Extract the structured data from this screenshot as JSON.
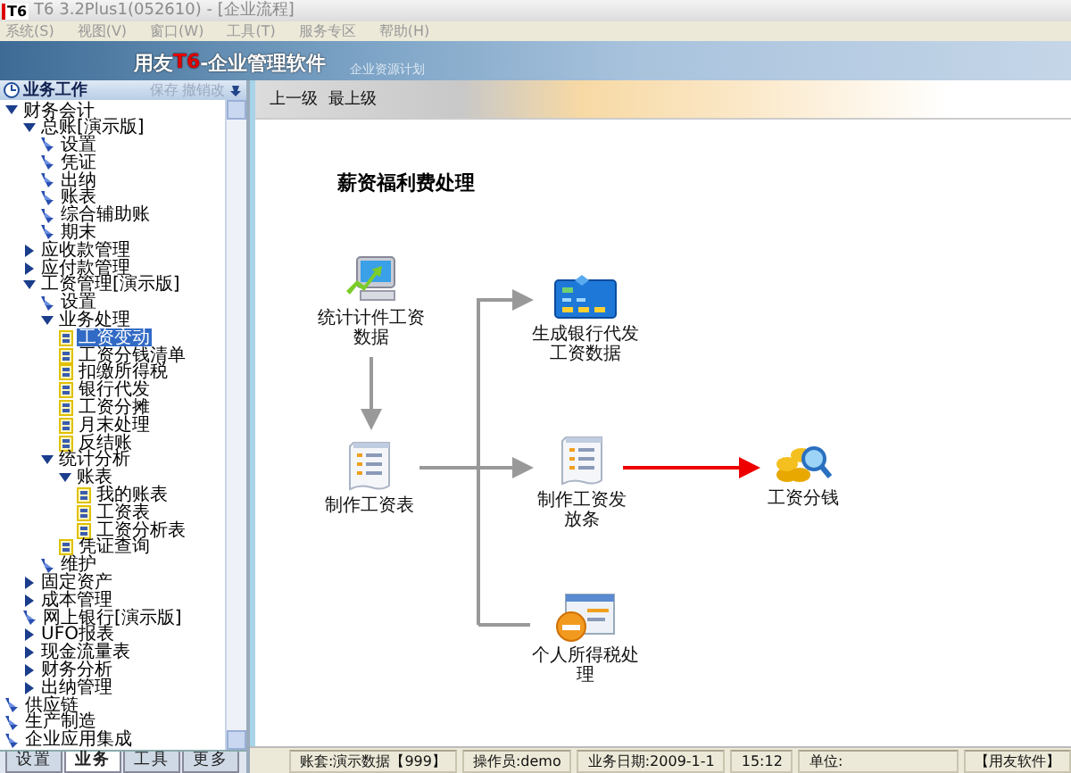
{
  "window": {
    "title": "T6 3.2Plus1(052610) - [企业流程]",
    "logo": "T6"
  },
  "menu": [
    {
      "label": "系统(S)"
    },
    {
      "label": "视图(V)"
    },
    {
      "label": "窗口(W)"
    },
    {
      "label": "工具(T)"
    },
    {
      "label": "服务专区"
    },
    {
      "label": "帮助(H)"
    }
  ],
  "banner": {
    "brand": [
      {
        "text": "用友",
        "highlight": false
      },
      {
        "text": "T6",
        "highlight": true
      },
      {
        "text": "-企业管理软件",
        "highlight": false
      }
    ],
    "subtitle": "企业资源计划"
  },
  "sidebar": {
    "title": "业务工作",
    "actions": [
      "保存",
      "撤销改"
    ],
    "tree": [
      {
        "label": "财务会计",
        "kind": "group",
        "expanded": true,
        "children": [
          {
            "label": "总账[演示版]",
            "kind": "group",
            "expanded": true,
            "children": [
              {
                "label": "设置",
                "kind": "link"
              },
              {
                "label": "凭证",
                "kind": "link"
              },
              {
                "label": "出纳",
                "kind": "link"
              },
              {
                "label": "账表",
                "kind": "link"
              },
              {
                "label": "综合辅助账",
                "kind": "link"
              },
              {
                "label": "期末",
                "kind": "link"
              }
            ]
          },
          {
            "label": "应收款管理",
            "kind": "group",
            "expanded": false
          },
          {
            "label": "应付款管理",
            "kind": "group",
            "expanded": false
          },
          {
            "label": "工资管理[演示版]",
            "kind": "group",
            "expanded": true,
            "children": [
              {
                "label": "设置",
                "kind": "link"
              },
              {
                "label": "业务处理",
                "kind": "group",
                "expanded": true,
                "children": [
                  {
                    "label": "工资变动",
                    "kind": "doc",
                    "selected": true
                  },
                  {
                    "label": "工资分钱清单",
                    "kind": "doc",
                    "selected": false
                  },
                  {
                    "label": "扣缴所得税",
                    "kind": "doc",
                    "selected": false
                  },
                  {
                    "label": "银行代发",
                    "kind": "doc",
                    "selected": false
                  },
                  {
                    "label": "工资分摊",
                    "kind": "doc",
                    "selected": false
                  },
                  {
                    "label": "月末处理",
                    "kind": "doc",
                    "selected": false
                  },
                  {
                    "label": "反结账",
                    "kind": "doc",
                    "selected": false
                  }
                ]
              },
              {
                "label": "统计分析",
                "kind": "group",
                "expanded": true,
                "children": [
                  {
                    "label": "账表",
                    "kind": "group",
                    "expanded": true,
                    "children": [
                      {
                        "label": "我的账表",
                        "kind": "doc",
                        "selected": false
                      },
                      {
                        "label": "工资表",
                        "kind": "doc",
                        "selected": false
                      },
                      {
                        "label": "工资分析表",
                        "kind": "doc",
                        "selected": false
                      }
                    ]
                  },
                  {
                    "label": "凭证查询",
                    "kind": "doc",
                    "selected": false
                  }
                ]
              },
              {
                "label": "维护",
                "kind": "link"
              }
            ]
          },
          {
            "label": "固定资产",
            "kind": "group",
            "expanded": false
          },
          {
            "label": "成本管理",
            "kind": "group",
            "expanded": false
          },
          {
            "label": "网上银行[演示版]",
            "kind": "link"
          },
          {
            "label": "UFO报表",
            "kind": "group",
            "expanded": false
          },
          {
            "label": "现金流量表",
            "kind": "group",
            "expanded": false
          },
          {
            "label": "财务分析",
            "kind": "group",
            "expanded": false
          },
          {
            "label": "出纳管理",
            "kind": "group",
            "expanded": false
          }
        ]
      },
      {
        "label": "供应链",
        "kind": "link"
      },
      {
        "label": "生产制造",
        "kind": "link"
      },
      {
        "label": "企业应用集成",
        "kind": "link"
      }
    ],
    "tabs": [
      {
        "label": "设置",
        "selected": false
      },
      {
        "label": "业务",
        "selected": true
      },
      {
        "label": "工具",
        "selected": false
      },
      {
        "label": "更多",
        "selected": false
      }
    ]
  },
  "toolbar": {
    "links": [
      "上一级",
      "最上级"
    ]
  },
  "diagram": {
    "title": "薪资福利费处理",
    "nodes": [
      {
        "label": "统计计件工资数据",
        "kind": "monitor"
      },
      {
        "label": "制作工资表",
        "kind": "sheet"
      },
      {
        "label": "生成银行代发工资数据",
        "kind": "bank"
      },
      {
        "label": "制作工资发放条",
        "kind": "sheet"
      },
      {
        "label": "工资分钱",
        "kind": "coins"
      },
      {
        "label": "个人所得税处理",
        "kind": "tax"
      }
    ]
  },
  "status_bar": [
    {
      "text": "账套:演示数据【999】"
    },
    {
      "text": "操作员:demo"
    },
    {
      "text": "业务日期:2009-1-1"
    },
    {
      "text": "15:12"
    },
    {
      "text": "单位:"
    },
    {
      "text": "【用友软件】"
    }
  ]
}
